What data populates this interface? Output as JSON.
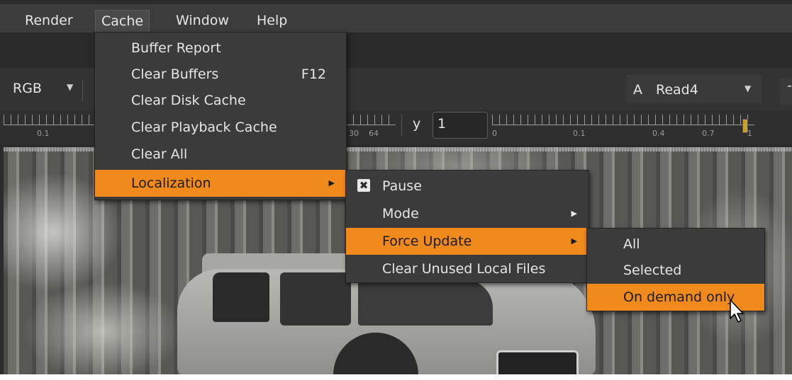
{
  "menubar": {
    "items": [
      {
        "label": "Render"
      },
      {
        "label": "Cache"
      },
      {
        "label": "Window"
      },
      {
        "label": "Help"
      }
    ]
  },
  "toolbar": {
    "channels": "RGB",
    "input_label": "A",
    "input_node": "Read4",
    "minus": "-",
    "y_label": "y",
    "y_value": "1"
  },
  "gain_slider": {
    "left_tick": "0.1",
    "mid_ticks": [
      "30",
      "64"
    ]
  },
  "gamma_slider": {
    "ticks": [
      "0",
      "0.1",
      "0.4",
      "0.7",
      "1"
    ]
  },
  "cache_menu": {
    "items": [
      {
        "label": "Buffer Report"
      },
      {
        "label": "Clear Buffers",
        "shortcut": "F12"
      },
      {
        "label": "Clear Disk Cache"
      },
      {
        "label": "Clear Playback Cache"
      },
      {
        "label": "Clear All"
      },
      {
        "label": "Localization"
      }
    ]
  },
  "localization_menu": {
    "items": [
      {
        "label": "Pause",
        "checked": true
      },
      {
        "label": "Mode"
      },
      {
        "label": "Force Update"
      },
      {
        "label": "Clear Unused Local Files"
      }
    ]
  },
  "force_update_menu": {
    "items": [
      {
        "label": "All"
      },
      {
        "label": "Selected"
      },
      {
        "label": "On demand only"
      }
    ]
  },
  "colors": {
    "highlight": "#f08a1c",
    "menu_bg": "#3b3b3b",
    "menubar_bg": "#3c3c3c"
  }
}
